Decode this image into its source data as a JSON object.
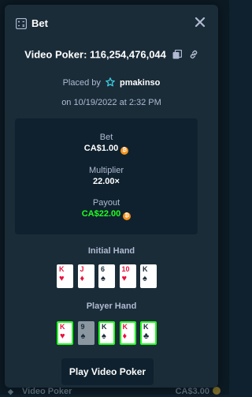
{
  "modal": {
    "title": "Bet",
    "game_line": "Video Poker: 116,254,476,044",
    "placed_by_prefix": "Placed by",
    "username": "pmakinso",
    "date_line": "on 10/19/2022 at 2:32 PM"
  },
  "stats": {
    "bet_label": "Bet",
    "bet_value": "CA$1.00",
    "multiplier_label": "Multiplier",
    "multiplier_value": "22.00×",
    "payout_label": "Payout",
    "payout_value": "CA$22.00",
    "currency_icon": "bitcoin-icon",
    "payout_color": "#1fff20"
  },
  "initial_hand": {
    "label": "Initial Hand",
    "cards": [
      {
        "rank": "K",
        "suit": "♥",
        "color": "red"
      },
      {
        "rank": "J",
        "suit": "♦",
        "color": "red"
      },
      {
        "rank": "6",
        "suit": "♠",
        "color": "black"
      },
      {
        "rank": "10",
        "suit": "♥",
        "color": "red"
      },
      {
        "rank": "K",
        "suit": "♠",
        "color": "black"
      }
    ]
  },
  "player_hand": {
    "label": "Player Hand",
    "cards": [
      {
        "rank": "K",
        "suit": "♥",
        "color": "red",
        "state": "held"
      },
      {
        "rank": "9",
        "suit": "♠",
        "color": "black",
        "state": "discarded"
      },
      {
        "rank": "K",
        "suit": "♠",
        "color": "black",
        "state": "held"
      },
      {
        "rank": "K",
        "suit": "♦",
        "color": "red",
        "state": "held"
      },
      {
        "rank": "K",
        "suit": "♣",
        "color": "black",
        "state": "held"
      }
    ]
  },
  "actions": {
    "play_label": "Play Video Poker"
  },
  "backdrop": {
    "game": "Video Poker",
    "amount": "CA$3.00"
  },
  "colors": {
    "modal_bg": "#1a2c38",
    "inner_bg": "#0f212e",
    "muted_text": "#b1bad3",
    "win_green": "#1fff20",
    "card_red": "#e9113c"
  }
}
